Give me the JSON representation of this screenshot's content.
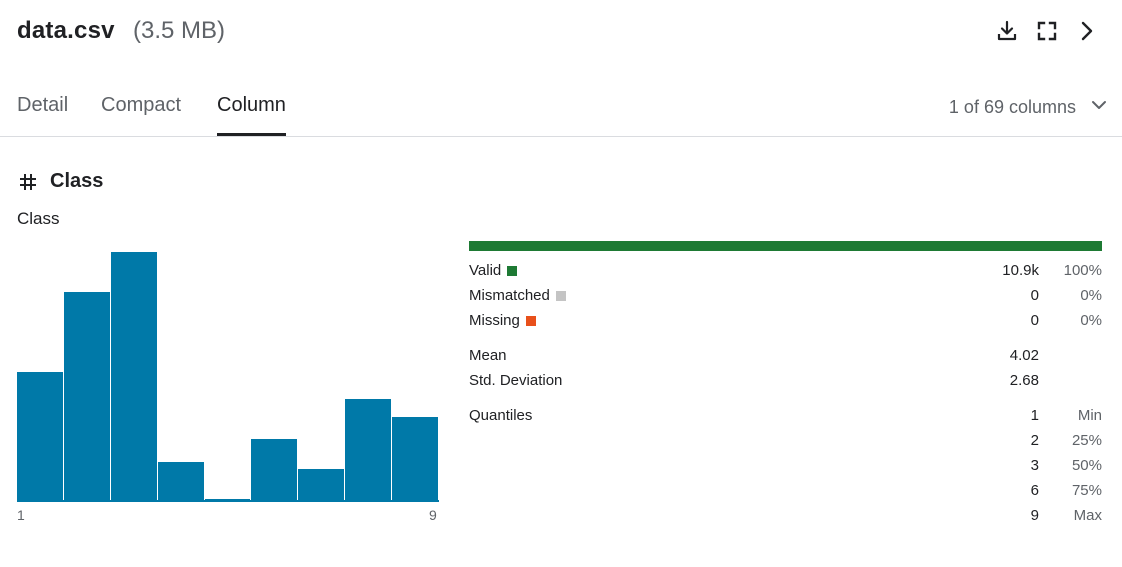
{
  "header": {
    "file_name": "data.csv",
    "file_size": "(3.5 MB)",
    "icons": [
      "download-icon",
      "fullscreen-icon",
      "chevron-right-icon"
    ]
  },
  "tabs": [
    {
      "label": "Detail",
      "active": false
    },
    {
      "label": "Compact",
      "active": false
    },
    {
      "label": "Column",
      "active": true
    }
  ],
  "column_selector": {
    "label": "1 of 69 columns",
    "icon": "chevron-down-icon"
  },
  "column": {
    "type_icon": "hash-icon",
    "name": "Class",
    "subtitle": "Class"
  },
  "chart_data": {
    "type": "bar",
    "title": "",
    "xlabel": "",
    "ylabel": "",
    "x_range": [
      "1",
      "9"
    ],
    "x_tick_labels": [
      "1",
      "9"
    ],
    "bins": 9,
    "values": [
      0.52,
      0.84,
      1.0,
      0.16,
      0.01,
      0.25,
      0.13,
      0.41,
      0.34
    ],
    "value_scale": "relative to tallest bar",
    "color": "#0079a8"
  },
  "validity": {
    "bar_color": "#1e7a34",
    "valid_fraction": 1.0,
    "rows": [
      {
        "label": "Valid",
        "value": "10.9k",
        "pct": "100%",
        "color": "#1e7a34"
      },
      {
        "label": "Mismatched",
        "value": "0",
        "pct": "0%",
        "color": "#c4c4c4"
      },
      {
        "label": "Missing",
        "value": "0",
        "pct": "0%",
        "color": "#e8501b"
      }
    ]
  },
  "summary": {
    "rows": [
      {
        "label": "Mean",
        "value": "4.02"
      },
      {
        "label": "Std. Deviation",
        "value": "2.68"
      }
    ]
  },
  "quantiles": {
    "label": "Quantiles",
    "rows": [
      {
        "value": "1",
        "name": "Min"
      },
      {
        "value": "2",
        "name": "25%"
      },
      {
        "value": "3",
        "name": "50%"
      },
      {
        "value": "6",
        "name": "75%"
      },
      {
        "value": "9",
        "name": "Max"
      }
    ]
  }
}
